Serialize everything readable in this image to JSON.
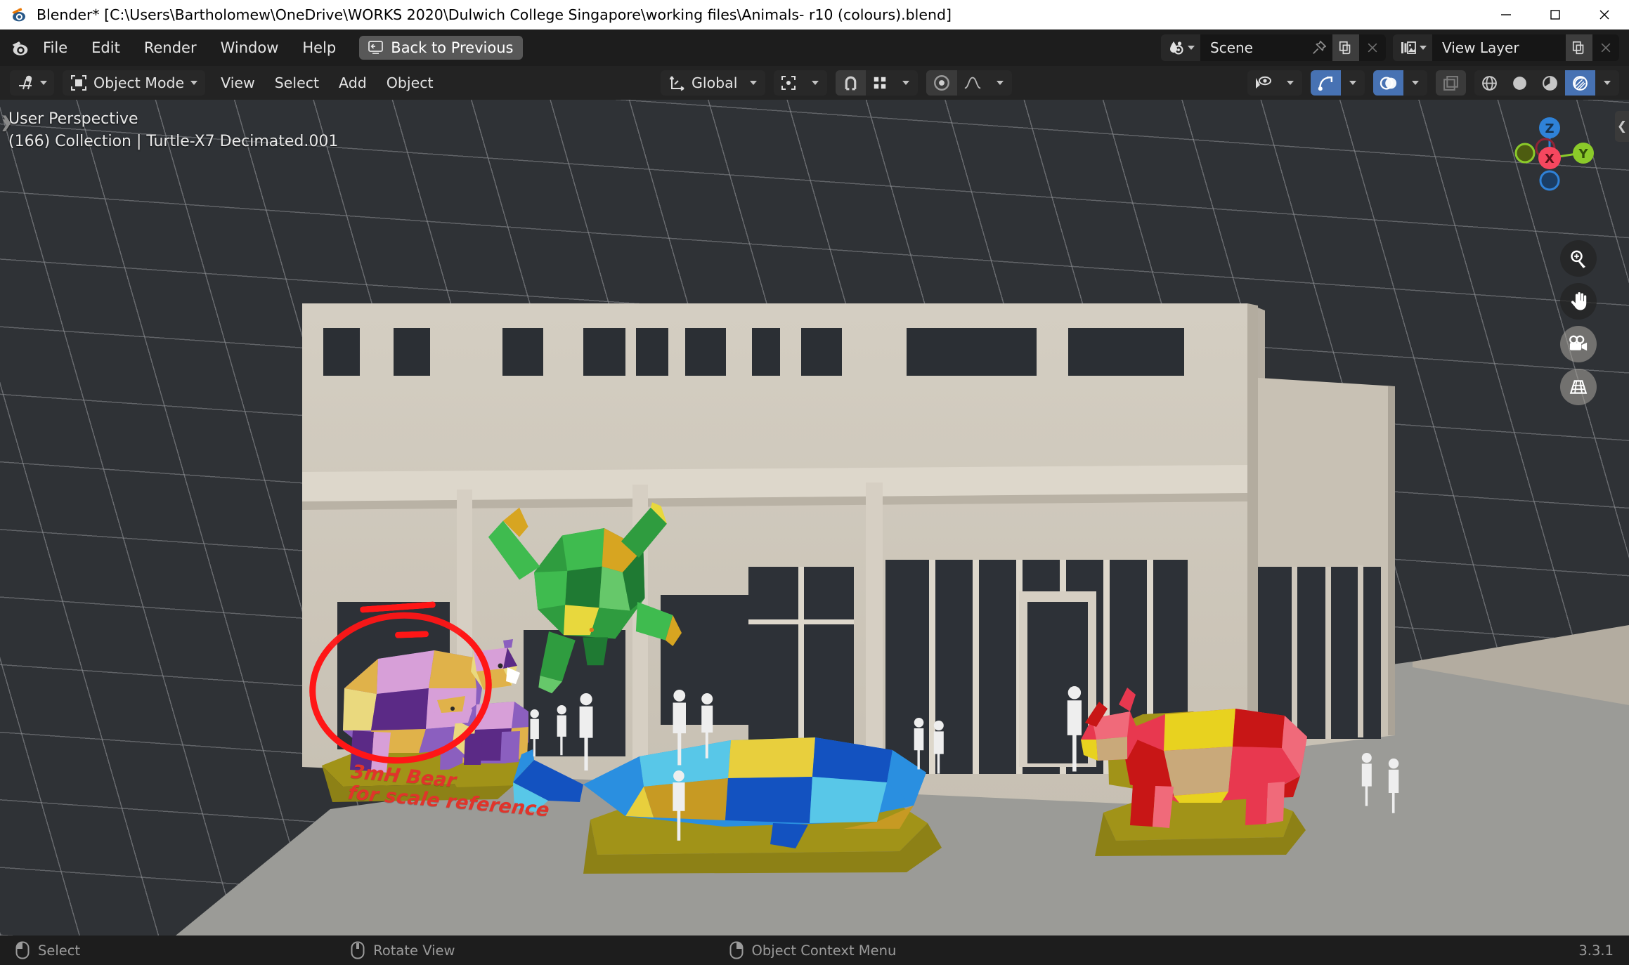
{
  "window": {
    "title": "Blender* [C:\\Users\\Bartholomew\\OneDrive\\WORKS 2020\\Dulwich College Singapore\\working files\\Animals- r10 (colours).blend]",
    "app_icon": "blender-logo-icon",
    "minimize": "minimize-icon",
    "maximize": "maximize-icon",
    "close": "close-icon"
  },
  "topbar": {
    "logo": "blender-logo-icon",
    "menus": [
      "File",
      "Edit",
      "Render",
      "Window",
      "Help"
    ],
    "back_to_previous": "Back to Previous",
    "back_icon": "back-arrow-screen-icon",
    "scene": {
      "icon": "scene-data-icon",
      "value": "Scene",
      "pin_icon": "pin-icon",
      "new_icon": "new-copy-icon",
      "unlink_icon": "x-icon"
    },
    "view_layer": {
      "icon": "view-layer-icon",
      "value": "View Layer",
      "new_icon": "new-copy-icon",
      "unlink_icon": "x-icon"
    }
  },
  "viewport_header": {
    "editor_type_icon": "editor-type-3d-viewport-icon",
    "mode": "Object Mode",
    "mode_icon": "object-mode-icon",
    "menus": [
      "View",
      "Select",
      "Add",
      "Object"
    ],
    "transform_orientation": "Global",
    "transform_orientation_icon": "orientation-axes-icon",
    "pivot_icon": "pivot-point-icon",
    "snap_magnet_icon": "snap-magnet-icon",
    "snap_to_icon": "snap-increment-icon",
    "proportional_edit_icon": "proportional-edit-icon",
    "falloff_icon": "falloff-curve-icon",
    "visibility_icon": "object-visibility-icon",
    "gizmo_icon": "gizmo-icon",
    "overlays_icon": "overlays-icon",
    "xray_icon": "xray-toggle-icon",
    "shading": [
      {
        "name": "shading-wireframe-icon",
        "active": false
      },
      {
        "name": "shading-solid-icon",
        "active": false
      },
      {
        "name": "shading-material-preview-icon",
        "active": false
      },
      {
        "name": "shading-rendered-icon",
        "active": true
      }
    ],
    "accent_blue": "#4772b3"
  },
  "viewport": {
    "perspective_label": "User Perspective",
    "context_label": "(166) Collection | Turtle-X7 Decimated.001",
    "gizmo_axes": [
      {
        "label": "Z",
        "color": "#2f82d8",
        "filled": true
      },
      {
        "label": "Y",
        "color": "#8bca2a",
        "filled": true
      },
      {
        "label": "X",
        "color": "#f6475f",
        "filled": true
      },
      {
        "label": "",
        "color": "#8bca2a",
        "filled": false
      },
      {
        "label": "",
        "color": "#2f82d8",
        "filled": false
      },
      {
        "label": "",
        "color": "#f6475f",
        "filled": false
      }
    ],
    "nav_buttons": [
      {
        "name": "zoom-view-icon"
      },
      {
        "name": "move-view-icon"
      },
      {
        "name": "camera-view-icon"
      },
      {
        "name": "toggle-perspective-icon"
      }
    ],
    "sidebar_toggle_icon": "chevron-left-icon",
    "toolbar_toggle_icon": "chevron-right-icon",
    "annotation": {
      "line1": "3mH Bear",
      "line2": "for scale reference",
      "color": "#e0342b",
      "circle_color": "#ff1616"
    },
    "colors": {
      "background": "#2f3236",
      "grid_line": "#96989c",
      "building_wall": "#cdc7bb",
      "building_wall_shadow": "#b8b1a5",
      "ground_plaza": "#9b9b97",
      "window_glass": "#2d3137",
      "plinth": "#a19318",
      "figure_white": "#eeeeee"
    },
    "sculptures": [
      {
        "name": "turtle-sculpture",
        "palette": [
          "#1f7a33",
          "#3bb54a",
          "#67c56a",
          "#d7a521",
          "#e8d83d"
        ]
      },
      {
        "name": "bear-sculpture",
        "palette": [
          "#5b2a86",
          "#8b5fbf",
          "#d79fd8",
          "#e0b24a",
          "#ead97e"
        ]
      },
      {
        "name": "bear-cub-sculpture",
        "palette": [
          "#5b2a86",
          "#8b5fbf",
          "#d79fd8",
          "#e0b24a"
        ]
      },
      {
        "name": "whale-sculpture",
        "palette": [
          "#1352c0",
          "#2a8fe0",
          "#58c7e8",
          "#c79a23",
          "#e8cf3d"
        ]
      },
      {
        "name": "rhino-sculpture",
        "palette": [
          "#c81616",
          "#e8384f",
          "#f06a7a",
          "#e8d21f",
          "#c9a97a"
        ]
      }
    ],
    "scale_figures": [
      "adult-figure",
      "child-figure",
      "adult-figure",
      "child-figure",
      "child-figure",
      "adult-figure",
      "child-figure",
      "child-figure",
      "adult-figure",
      "child-figure",
      "child-figure"
    ]
  },
  "statusbar": {
    "items": [
      {
        "icon": "mouse-left-button-icon",
        "label": "Select"
      },
      {
        "icon": "mouse-middle-button-icon",
        "label": "Rotate View"
      },
      {
        "icon": "mouse-right-button-icon",
        "label": "Object Context Menu"
      }
    ],
    "version": "3.3.1"
  }
}
